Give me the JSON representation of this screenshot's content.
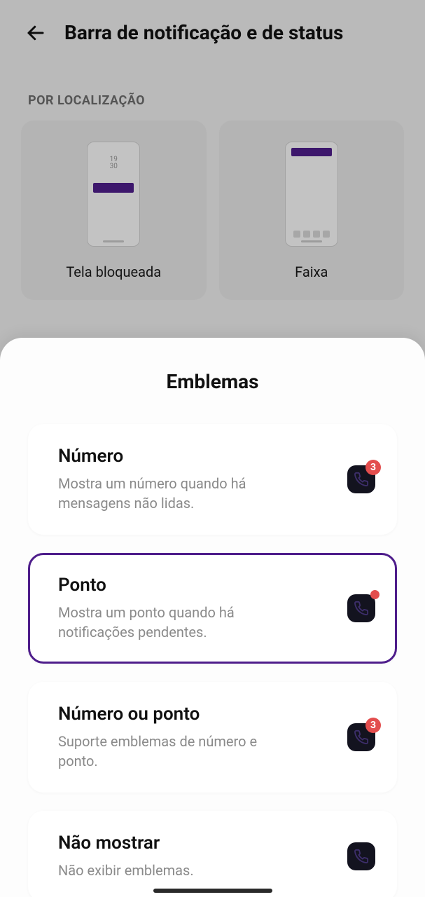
{
  "header": {
    "title": "Barra de notificação e de status"
  },
  "section": {
    "label": "POR LOCALIZAÇÃO",
    "options": [
      {
        "label": "Tela bloqueada",
        "clock": "19\n30"
      },
      {
        "label": "Faixa"
      }
    ]
  },
  "sheet": {
    "title": "Emblemas",
    "badge_count": "3",
    "choices": [
      {
        "title": "Número",
        "subtitle": "Mostra um número quando há mensagens não lidas.",
        "badge_type": "number",
        "selected": false
      },
      {
        "title": "Ponto",
        "subtitle": "Mostra um ponto quando há notificações pendentes.",
        "badge_type": "dot",
        "selected": true
      },
      {
        "title": "Número ou ponto",
        "subtitle": "Suporte emblemas de número e ponto.",
        "badge_type": "number",
        "selected": false
      },
      {
        "title": "Não mostrar",
        "subtitle": "Não exibir emblemas.",
        "badge_type": "none",
        "selected": false
      }
    ]
  }
}
